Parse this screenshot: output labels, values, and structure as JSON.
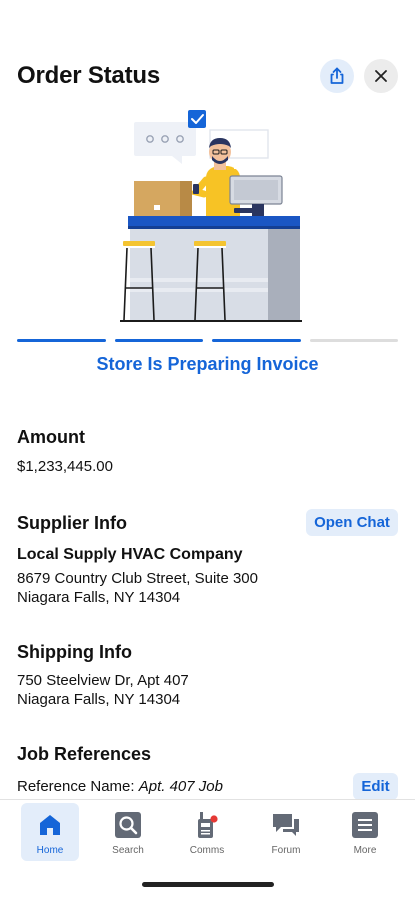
{
  "header": {
    "title": "Order Status"
  },
  "status": {
    "progress_steps_total": 4,
    "progress_steps_done": 3,
    "label": "Store Is Preparing Invoice"
  },
  "amount": {
    "heading": "Amount",
    "value": "$1,233,445.00"
  },
  "supplier": {
    "heading": "Supplier Info",
    "open_chat_label": "Open Chat",
    "name": "Local Supply HVAC Company",
    "address_line1": "8679 Country Club Street, Suite 300",
    "address_line2": "Niagara Falls, NY 14304"
  },
  "shipping": {
    "heading": "Shipping Info",
    "address_line1": "750 Steelview Dr, Apt 407",
    "address_line2": "Niagara Falls, NY 14304"
  },
  "job_refs": {
    "heading": "Job References",
    "ref_label": "Reference Name:",
    "ref_value": "Apt. 407 Job",
    "edit_label": "Edit"
  },
  "tabbar": {
    "items": [
      {
        "label": "Home",
        "icon": "home-icon",
        "active": true
      },
      {
        "label": "Search",
        "icon": "search-icon",
        "active": false
      },
      {
        "label": "Comms",
        "icon": "radio-icon",
        "active": false
      },
      {
        "label": "Forum",
        "icon": "chat-bubbles-icon",
        "active": false
      },
      {
        "label": "More",
        "icon": "menu-icon",
        "active": false
      }
    ]
  },
  "colors": {
    "accent": "#1565d8",
    "accent_bg": "#e3edfa",
    "notification_dot": "#e53935"
  }
}
